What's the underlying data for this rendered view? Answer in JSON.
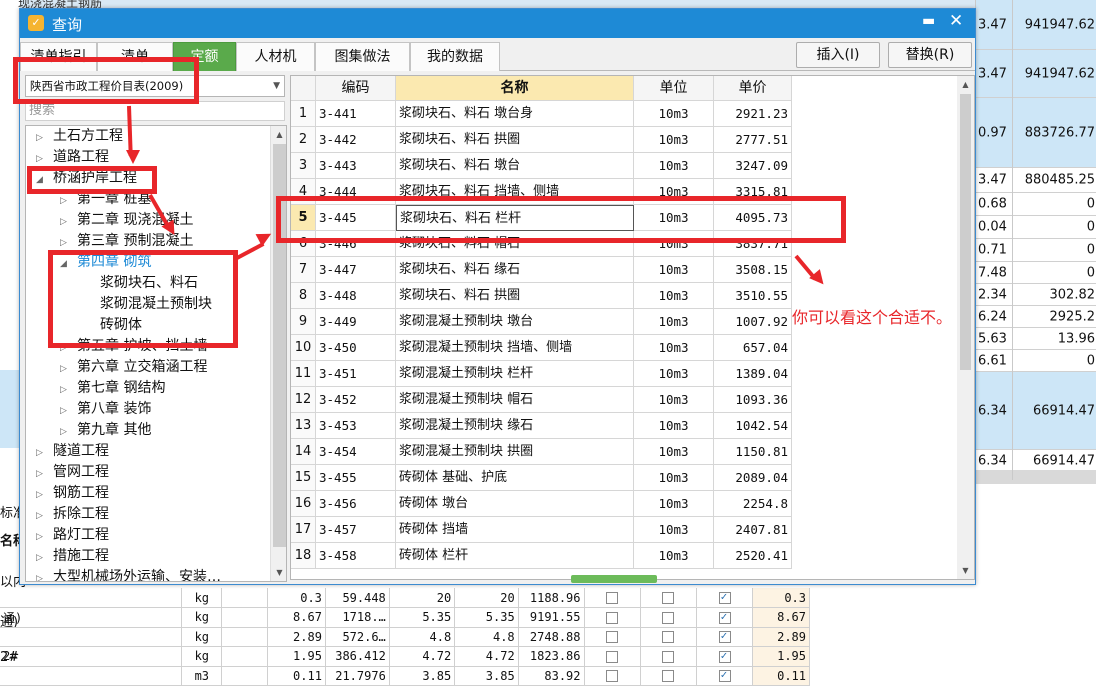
{
  "background": {
    "top_text": "现浇混凝土钢筋",
    "right_rows": [
      {
        "a": "3.47",
        "b": "941947.62",
        "blue": true
      },
      {
        "a": "3.47",
        "b": "941947.62",
        "blue": true
      },
      {
        "a": "0.97",
        "b": "883726.77",
        "blue": true
      },
      {
        "a": "3.47",
        "b": "880485.25",
        "blue": false
      },
      {
        "a": "0.68",
        "b": "0",
        "blue": false
      },
      {
        "a": "0.04",
        "b": "0",
        "blue": false
      },
      {
        "a": "0.71",
        "b": "0",
        "blue": false
      },
      {
        "a": "7.48",
        "b": "0",
        "blue": false
      },
      {
        "a": "2.34",
        "b": "302.82",
        "blue": false
      },
      {
        "a": "6.24",
        "b": "2925.2",
        "blue": false
      },
      {
        "a": "5.63",
        "b": "13.96",
        "blue": false
      },
      {
        "a": "6.61",
        "b": "0",
        "blue": false
      },
      {
        "a": "6.34",
        "b": "66914.47",
        "blue": true
      },
      {
        "a": "6.34",
        "b": "66914.47",
        "blue": false
      }
    ],
    "left_labels": [
      "标准",
      "名称",
      "以内",
      "通)",
      "",
      "2#",
      ""
    ],
    "bottom_rows": [
      {
        "name": "",
        "unit": "kg",
        "q": "0.3",
        "v": "59.448",
        "p1": "20",
        "p2": "20",
        "t": "1188.96",
        "c1": false,
        "c2": false,
        "c3": true,
        "last": "0.3"
      },
      {
        "name": "通)",
        "unit": "kg",
        "q": "8.67",
        "v": "1718.…",
        "p1": "5.35",
        "p2": "5.35",
        "t": "9191.55",
        "c1": false,
        "c2": false,
        "c3": true,
        "last": "8.67"
      },
      {
        "name": "",
        "unit": "kg",
        "q": "2.89",
        "v": "572.6…",
        "p1": "4.8",
        "p2": "4.8",
        "t": "2748.88",
        "c1": false,
        "c2": false,
        "c3": true,
        "last": "2.89"
      },
      {
        "name": "2#",
        "unit": "kg",
        "q": "1.95",
        "v": "386.412",
        "p1": "4.72",
        "p2": "4.72",
        "t": "1823.86",
        "c1": false,
        "c2": false,
        "c3": true,
        "last": "1.95"
      },
      {
        "name": "",
        "unit": "m3",
        "q": "0.11",
        "v": "21.7976",
        "p1": "3.85",
        "p2": "3.85",
        "t": "83.92",
        "c1": false,
        "c2": false,
        "c3": true,
        "last": "0.11"
      }
    ]
  },
  "dialog": {
    "title": "查询",
    "minimize": "▬",
    "close": "✕",
    "tabs": [
      "清单指引",
      "清单",
      "定额",
      "人材机",
      "图集做法",
      "我的数据"
    ],
    "active_tab": "定额",
    "insert_button": "插入(I)",
    "replace_button": "替换(R)",
    "library": "陕西省市政工程价目表(2009)",
    "search_placeholder": "搜索"
  },
  "tree": [
    {
      "label": "土石方工程",
      "toggle": "▷",
      "level": 0
    },
    {
      "label": "道路工程",
      "toggle": "▷",
      "level": 0
    },
    {
      "label": "桥涵护岸工程",
      "toggle": "◢",
      "level": 0
    },
    {
      "label": "第一章 桩基",
      "toggle": "▷",
      "level": 1
    },
    {
      "label": "第二章 现浇混凝土",
      "toggle": "▷",
      "level": 1
    },
    {
      "label": "第三章 预制混凝土",
      "toggle": "▷",
      "level": 1
    },
    {
      "label": "第四章 砌筑",
      "toggle": "◢",
      "level": 1,
      "selected": true
    },
    {
      "label": "浆砌块石、料石",
      "toggle": "",
      "level": 2
    },
    {
      "label": "浆砌混凝土预制块",
      "toggle": "",
      "level": 2
    },
    {
      "label": "砖砌体",
      "toggle": "",
      "level": 2
    },
    {
      "label": "第五章 护坡、挡土墙",
      "toggle": "▷",
      "level": 1
    },
    {
      "label": "第六章 立交箱涵工程",
      "toggle": "▷",
      "level": 1
    },
    {
      "label": "第七章 钢结构",
      "toggle": "▷",
      "level": 1
    },
    {
      "label": "第八章 装饰",
      "toggle": "▷",
      "level": 1
    },
    {
      "label": "第九章 其他",
      "toggle": "▷",
      "level": 1
    },
    {
      "label": "隧道工程",
      "toggle": "▷",
      "level": 0
    },
    {
      "label": "管网工程",
      "toggle": "▷",
      "level": 0
    },
    {
      "label": "钢筋工程",
      "toggle": "▷",
      "level": 0
    },
    {
      "label": "拆除工程",
      "toggle": "▷",
      "level": 0
    },
    {
      "label": "路灯工程",
      "toggle": "▷",
      "level": 0
    },
    {
      "label": "措施工程",
      "toggle": "▷",
      "level": 0
    },
    {
      "label": "大型机械场外运输、安装…",
      "toggle": "▷",
      "level": 0
    }
  ],
  "grid": {
    "headers": [
      "",
      "编码",
      "名称",
      "单位",
      "单价"
    ],
    "selected_row": 5,
    "rows": [
      {
        "n": "1",
        "code": "3-441",
        "name": "浆砌块石、料石 墩台身",
        "unit": "10m3",
        "price": "2921.23"
      },
      {
        "n": "2",
        "code": "3-442",
        "name": "浆砌块石、料石 拱圈",
        "unit": "10m3",
        "price": "2777.51"
      },
      {
        "n": "3",
        "code": "3-443",
        "name": "浆砌块石、料石 墩台",
        "unit": "10m3",
        "price": "3247.09"
      },
      {
        "n": "4",
        "code": "3-444",
        "name": "浆砌块石、料石 挡墙、侧墙",
        "unit": "10m3",
        "price": "3315.81"
      },
      {
        "n": "5",
        "code": "3-445",
        "name": "浆砌块石、料石 栏杆",
        "unit": "10m3",
        "price": "4095.73"
      },
      {
        "n": "6",
        "code": "3-446",
        "name": "浆砌块石、料石 帽石",
        "unit": "10m3",
        "price": "3837.71"
      },
      {
        "n": "7",
        "code": "3-447",
        "name": "浆砌块石、料石 缘石",
        "unit": "10m3",
        "price": "3508.15"
      },
      {
        "n": "8",
        "code": "3-448",
        "name": "浆砌块石、料石 拱圈",
        "unit": "10m3",
        "price": "3510.55"
      },
      {
        "n": "9",
        "code": "3-449",
        "name": "浆砌混凝土预制块 墩台",
        "unit": "10m3",
        "price": "1007.92"
      },
      {
        "n": "10",
        "code": "3-450",
        "name": "浆砌混凝土预制块 挡墙、侧墙",
        "unit": "10m3",
        "price": "657.04"
      },
      {
        "n": "11",
        "code": "3-451",
        "name": "浆砌混凝土预制块 栏杆",
        "unit": "10m3",
        "price": "1389.04"
      },
      {
        "n": "12",
        "code": "3-452",
        "name": "浆砌混凝土预制块 帽石",
        "unit": "10m3",
        "price": "1093.36"
      },
      {
        "n": "13",
        "code": "3-453",
        "name": "浆砌混凝土预制块 缘石",
        "unit": "10m3",
        "price": "1042.54"
      },
      {
        "n": "14",
        "code": "3-454",
        "name": "浆砌混凝土预制块 拱圈",
        "unit": "10m3",
        "price": "1150.81"
      },
      {
        "n": "15",
        "code": "3-455",
        "name": "砖砌体 基础、护底",
        "unit": "10m3",
        "price": "2089.04"
      },
      {
        "n": "16",
        "code": "3-456",
        "name": "砖砌体 墩台",
        "unit": "10m3",
        "price": "2254.8"
      },
      {
        "n": "17",
        "code": "3-457",
        "name": "砖砌体 挡墙",
        "unit": "10m3",
        "price": "2407.81"
      },
      {
        "n": "18",
        "code": "3-458",
        "name": "砖砌体 栏杆",
        "unit": "10m3",
        "price": "2520.41"
      }
    ]
  },
  "annotation": {
    "note": "你可以看这个合适不。",
    "color": "#e8262a"
  },
  "colors": {
    "titlebar": "#1e8ad6",
    "active_tab": "#5aaa4b",
    "selected_tree": "#1e8ad6",
    "header_highlight": "#fbe9b0"
  }
}
